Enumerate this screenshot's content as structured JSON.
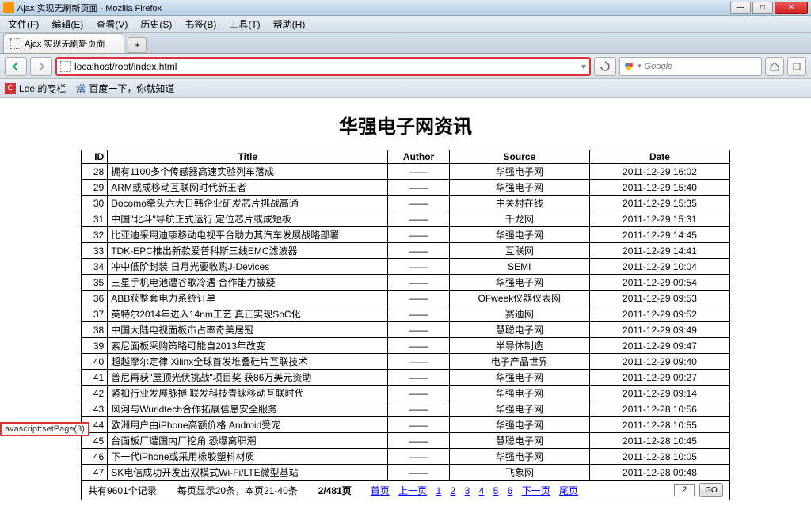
{
  "window": {
    "title": "Ajax 实现无刷新页面 - Mozilla Firefox",
    "tab_title": "Ajax 实现无刷新页面"
  },
  "menu": {
    "file": "文件(F)",
    "edit": "编辑(E)",
    "view": "查看(V)",
    "history": "历史(S)",
    "bookmarks": "书签(B)",
    "tools": "工具(T)",
    "help": "帮助(H)"
  },
  "addressbar": {
    "url": "localhost/root/index.html",
    "search_placeholder": "Google"
  },
  "bookmarks_bar": {
    "item1": "Lee.的专栏",
    "item2": "百度一下，你就知道"
  },
  "page": {
    "title": "华强电子网资讯",
    "headers": {
      "id": "ID",
      "title": "Title",
      "author": "Author",
      "source": "Source",
      "date": "Date"
    },
    "rows": [
      {
        "id": "28",
        "title": "拥有1100多个传感器高速实验列车落成",
        "author": "——",
        "source": "华强电子网",
        "date": "2011-12-29 16:02"
      },
      {
        "id": "29",
        "title": "ARM或成移动互联网时代新王者",
        "author": "——",
        "source": "华强电子网",
        "date": "2011-12-29 15:40"
      },
      {
        "id": "30",
        "title": "Docomo牵头六大日韩企业研发芯片挑战高通",
        "author": "——",
        "source": "中关村在线",
        "date": "2011-12-29 15:35"
      },
      {
        "id": "31",
        "title": "中国\"北斗\"导航正式运行 定位芯片或成短板",
        "author": "——",
        "source": "千龙网",
        "date": "2011-12-29 15:31"
      },
      {
        "id": "32",
        "title": "比亚迪采用迪康移动电视平台助力其汽车发展战略部署",
        "author": "——",
        "source": "华强电子网",
        "date": "2011-12-29 14:45"
      },
      {
        "id": "33",
        "title": "TDK-EPC推出新款爱普科斯三线EMC滤波器",
        "author": "——",
        "source": "互联网",
        "date": "2011-12-29 14:41"
      },
      {
        "id": "34",
        "title": "冲中低阶封装 日月光要收购J-Devices",
        "author": "——",
        "source": "SEMI",
        "date": "2011-12-29 10:04"
      },
      {
        "id": "35",
        "title": "三星手机电池遭谷歌冷遇 合作能力被疑",
        "author": "——",
        "source": "华强电子网",
        "date": "2011-12-29 09:54"
      },
      {
        "id": "36",
        "title": "ABB获整套电力系统订单",
        "author": "——",
        "source": "OFweek仪器仪表网",
        "date": "2011-12-29 09:53"
      },
      {
        "id": "37",
        "title": "英特尔2014年进入14nm工艺 真正实现SoC化",
        "author": "——",
        "source": "赛迪网",
        "date": "2011-12-29 09:52"
      },
      {
        "id": "38",
        "title": "中国大陆电视面板市占率奇美居冠",
        "author": "——",
        "source": "慧聪电子网",
        "date": "2011-12-29 09:49"
      },
      {
        "id": "39",
        "title": "索尼面板采购策略可能自2013年改变",
        "author": "——",
        "source": "半导体制造",
        "date": "2011-12-29 09:47"
      },
      {
        "id": "40",
        "title": "超越摩尔定律 Xilinx全球首发堆叠硅片互联技术",
        "author": "——",
        "source": "电子产品世界",
        "date": "2011-12-29 09:40"
      },
      {
        "id": "41",
        "title": "普尼再获\"屋顶光伏挑战\"项目奖 获86万美元资助",
        "author": "——",
        "source": "华强电子网",
        "date": "2011-12-29 09:27"
      },
      {
        "id": "42",
        "title": "紧扣行业发展脉搏 联发科技青睐移动互联时代",
        "author": "——",
        "source": "华强电子网",
        "date": "2011-12-29 09:14"
      },
      {
        "id": "43",
        "title": "风河与Wurldtech合作拓展信息安全服务",
        "author": "——",
        "source": "华强电子网",
        "date": "2011-12-28 10:56"
      },
      {
        "id": "44",
        "title": "欧洲用户由iPhone高额价格 Android受宠",
        "author": "——",
        "source": "华强电子网",
        "date": "2011-12-28 10:55"
      },
      {
        "id": "45",
        "title": "台面板厂遭国内厂挖角 恐爆离职潮",
        "author": "——",
        "source": "慧聪电子网",
        "date": "2011-12-28 10:45"
      },
      {
        "id": "46",
        "title": "下一代iPhone或采用橡胶塑料材质",
        "author": "——",
        "source": "华强电子网",
        "date": "2011-12-28 10:05"
      },
      {
        "id": "47",
        "title": "SK电信成功开发出双模式Wi-Fi/LTE微型基站",
        "author": "——",
        "source": "飞象网",
        "date": "2011-12-28 09:48"
      }
    ],
    "pager": {
      "total": "共有9601个记录",
      "perpage": "每页显示20条，本页21-40条",
      "pages": "2/481页",
      "first": "首页",
      "prev": "上一页",
      "p1": "1",
      "p2": "2",
      "p3": "3",
      "p4": "4",
      "p5": "5",
      "p6": "6",
      "next": "下一页",
      "last": "尾页",
      "input_value": "2",
      "go": "GO"
    }
  },
  "statusbar": "avascript:setPage(3)"
}
